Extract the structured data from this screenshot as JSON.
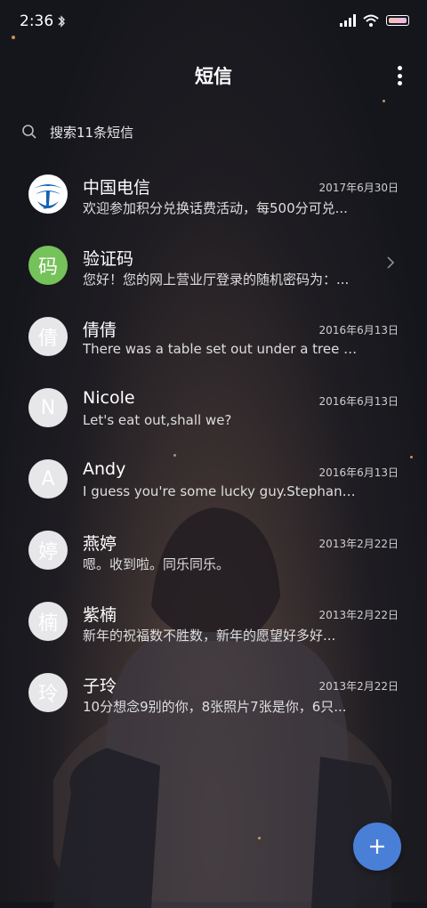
{
  "status_bar": {
    "time": "2:36",
    "bluetooth_icon": "bluetooth-icon",
    "signal_icon": "signal-icon",
    "wifi_icon": "wifi-icon",
    "battery_icon": "battery-icon"
  },
  "header": {
    "title": "短信",
    "more_icon": "more-vert-icon"
  },
  "search": {
    "placeholder": "搜索11条短信",
    "icon": "search-icon"
  },
  "conversations": [
    {
      "name": "中国电信",
      "date": "2017年6月30日",
      "preview": "欢迎参加积分兑换话费活动，每500分可兑...",
      "avatar": "china-telecom-logo"
    },
    {
      "name": "验证码",
      "date": "",
      "preview": "您好！您的网上营业厅登录的随机密码为：...",
      "avatar_text": "码",
      "avatar_color": "#76c25a"
    },
    {
      "name": "倩倩",
      "date": "2016年6月13日",
      "preview": "There was a table set out under a tree in...",
      "avatar_text": "倩"
    },
    {
      "name": "Nicole",
      "date": "2016年6月13日",
      "preview": "Let's eat out,shall we?",
      "avatar_text": "N"
    },
    {
      "name": "Andy",
      "date": "2016年6月13日",
      "preview": "I guess you're some lucky guy.Stephani...",
      "avatar_text": "A"
    },
    {
      "name": "燕婷",
      "date": "2013年2月22日",
      "preview": "嗯。收到啦。同乐同乐。",
      "avatar_text": "婷"
    },
    {
      "name": "紫楠",
      "date": "2013年2月22日",
      "preview": "新年的祝福数不胜数，新年的愿望好多好...",
      "avatar_text": "楠"
    },
    {
      "name": "子玲",
      "date": "2013年2月22日",
      "preview": "10分想念9别的你，8张照片7张是你，6只...",
      "avatar_text": "玲"
    }
  ],
  "fab": {
    "icon": "plus-icon",
    "color": "#4a7fd8"
  }
}
